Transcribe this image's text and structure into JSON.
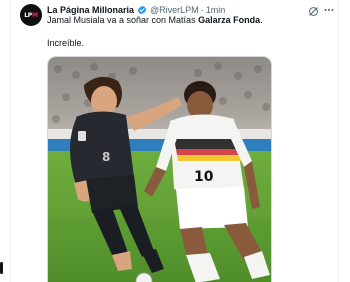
{
  "tweet": {
    "author_name": "La Página Millonaria",
    "author_handle": "@RiverLPM",
    "separator": "·",
    "timestamp": "1min",
    "avatar_text_a": "LP",
    "avatar_text_b": "M",
    "line1_part1": "Jamal Musiala va a soñar con Matías ",
    "line1_bold": "Galarza Fonda",
    "line1_end": ".",
    "line2": "Increíble."
  },
  "media": {
    "jersey_number_white": "10",
    "jersey_number_dark": "8"
  },
  "icons": {
    "verified": "verified-badge-icon",
    "grok": "grok-icon",
    "more": "more-options-icon"
  },
  "colors": {
    "verified_blue": "#1d9bf0",
    "muted_text": "#536471",
    "border": "#cfd9de"
  }
}
